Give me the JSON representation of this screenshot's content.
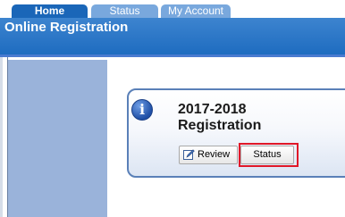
{
  "tabs": [
    {
      "label": "Home",
      "active": true
    },
    {
      "label": "Status",
      "active": false
    },
    {
      "label": "My Account",
      "active": false
    }
  ],
  "header": {
    "title": "Online Registration"
  },
  "card": {
    "title_line1": "2017-2018",
    "title_line2": "Registration",
    "icon": "info-icon",
    "review_label": "Review",
    "review_icon": "edit-pencil-icon",
    "status_label": "Status"
  },
  "colors": {
    "active_tab": "#1a66b8",
    "inactive_tab": "#79a8dd",
    "header": "#2a74c6",
    "sidebar": "#9ab3da",
    "card_border": "#5a80b8",
    "highlight": "#e01828"
  }
}
